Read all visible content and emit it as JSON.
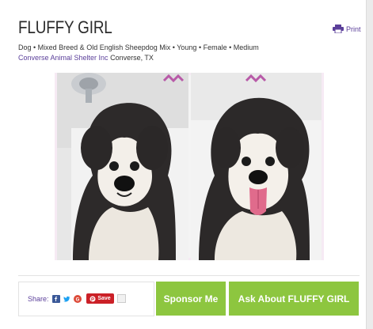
{
  "pet": {
    "name": "FLUFFY GIRL",
    "details": "Dog • Mixed Breed & Old English Sheepdog Mix • Young • Female • Medium",
    "shelter_name": "Converse Animal Shelter Inc",
    "location": "Converse, TX"
  },
  "actions": {
    "print_label": "Print",
    "share_label": "Share:",
    "save_label": "Save",
    "sponsor_label": "Sponsor Me",
    "ask_label": "Ask About FLUFFY GIRL"
  },
  "icons": {
    "print": "printer-icon",
    "facebook": "facebook-icon",
    "twitter": "twitter-icon",
    "googleplus": "google-plus-icon",
    "pinterest": "pinterest-icon"
  },
  "colors": {
    "accent": "#5b3f9a",
    "button_green": "#8dc63f",
    "pinterest_red": "#cb2027"
  }
}
